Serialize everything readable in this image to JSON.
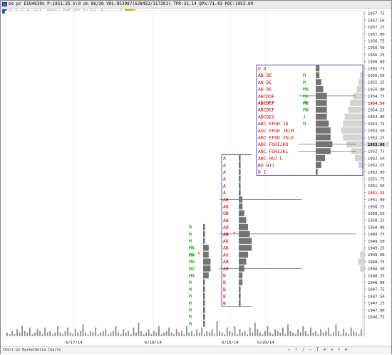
{
  "window": {
    "title_bar": "es pr ESU4630n P:1951.25 V:0 on 06/20 VOL:852987(628452/117281) TPR:31.14 QPx:71.43 POC:1953.00",
    "subtitle_prefix": "Market Profile MCD14 CME  All Rights Reserved",
    "subtitle_mark": "DCSu",
    "footer_label": "Chart by MarketDelta Charts"
  },
  "colors": {
    "accent_red": "#cc0000",
    "profile_red": "#c00000",
    "profile_green": "#009000",
    "histogram_bar": "#737373",
    "profile_box_border": "#2a2a9e",
    "last_price_label": "#ff0000"
  },
  "chart_data": {
    "type": "bar",
    "title": "",
    "xlabel": "",
    "ylabel": "",
    "ylim": [
      1946.75,
      1957.75
    ],
    "tick_step": 0.25,
    "price_ticks": [
      "1957.75",
      "1957.50",
      "1957.25",
      "1957.00",
      "1956.75",
      "1956.50",
      "1956.25",
      "1956.00",
      "1955.75",
      "1955.50",
      "1955.25",
      "1955.00",
      "1954.75",
      "1954.50",
      "1954.25",
      "1954.00",
      "1953.75",
      "1953.50",
      "1953.25",
      "1953.00",
      "1952.75",
      "1952.50",
      "1952.25",
      "1952.00",
      "1951.75",
      "1951.50",
      "1951.25",
      "1951.00",
      "1950.75",
      "1950.50",
      "1950.25",
      "1950.00",
      "1949.75",
      "1949.50",
      "1949.25",
      "1949.00",
      "1948.75",
      "1948.50",
      "1948.25",
      "1948.00",
      "1947.75",
      "1947.50",
      "1947.25",
      "1947.00",
      "1946.75"
    ],
    "highlighted_ticks": {
      "1954.50": "#cc0000",
      "1951.25": "#ff0000",
      "1953.00": "#000000"
    },
    "date_labels": [
      "6/17/14",
      "6/18/14",
      "6/19/14",
      "6/20/14"
    ],
    "profiles": [
      {
        "session": "6/18/14",
        "top": 1950.0,
        "rows": [
          "M",
          "M",
          "M",
          "MN",
          "MN",
          "MN",
          "MO",
          "MN",
          "M",
          "M",
          "M",
          "M",
          "M",
          "M",
          "M"
        ],
        "hist": [
          1,
          1,
          1,
          3,
          3,
          4,
          4,
          3,
          1,
          1,
          1,
          1,
          1,
          1,
          1
        ],
        "poc": 1949.0,
        "marker": "*"
      },
      {
        "session": "6/19/14",
        "top": 1952.5,
        "rows": [
          "A",
          "A",
          "A",
          "A",
          "A",
          "A",
          "AB",
          "AB",
          "OB",
          "AB",
          "AB",
          "AB",
          "AB",
          "AB",
          "AO",
          "AB",
          "AB",
          "B",
          "B",
          "B",
          "B",
          "B"
        ],
        "hist": [
          1,
          1,
          1,
          1,
          1,
          1,
          2,
          2,
          3,
          4,
          5,
          6,
          7,
          7,
          5,
          4,
          3,
          2,
          2,
          1,
          1,
          1
        ],
        "poc": 1949.75,
        "marker": "*",
        "value_area": [
          1951.0,
          1948.5
        ]
      },
      {
        "session": "6/20/14",
        "top": 1955.75,
        "rows": [
          "O D",
          "AB DE",
          "AB DE",
          "AB DE",
          "ABCDOF",
          "ABCDEF",
          "ABCDEF",
          "ABCDEO",
          "ABC EFGH JO",
          "AOC EFGH JKLM",
          "ABC EFOO JKLO",
          "ABC FGHIJKO",
          "ABC FGHIJKL",
          "ABC HOJ L",
          "BO HIJ",
          "B I"
        ],
        "right_letters": [
          "",
          "M",
          "M",
          "MN",
          "MO",
          "MN",
          "MN",
          "J",
          "M",
          "",
          "",
          "",
          "",
          "",
          "",
          ""
        ],
        "hist": [
          2,
          2,
          3,
          4,
          6,
          6,
          6,
          6,
          7,
          8,
          8,
          9,
          8,
          5,
          3,
          1
        ],
        "poc": 1954.5,
        "marker": "*"
      }
    ],
    "composite_right": [
      {
        "price": 1955.5,
        "value": 2
      },
      {
        "price": 1955.25,
        "value": 3
      },
      {
        "price": 1955.0,
        "value": 4
      },
      {
        "price": 1954.75,
        "value": 6
      },
      {
        "price": 1954.5,
        "value": 8
      },
      {
        "price": 1954.25,
        "value": 9
      },
      {
        "price": 1954.0,
        "value": 11
      },
      {
        "price": 1953.75,
        "value": 12
      },
      {
        "price": 1953.5,
        "value": 13
      },
      {
        "price": 1953.25,
        "value": 12
      },
      {
        "price": 1953.0,
        "value": 10
      },
      {
        "price": 1952.75,
        "value": 7
      },
      {
        "price": 1952.5,
        "value": 5
      },
      {
        "price": 1952.25,
        "value": 3
      },
      {
        "price": 1949.0,
        "value": 2
      },
      {
        "price": 1948.75,
        "value": 3
      },
      {
        "price": 1948.5,
        "value": 2
      }
    ],
    "volume": [
      2,
      1,
      3,
      1,
      4,
      2,
      6,
      3,
      2,
      5,
      1,
      2,
      4,
      3,
      1,
      5,
      2,
      3,
      1,
      2,
      6,
      2,
      1,
      3,
      5,
      2,
      1,
      4,
      2,
      3,
      7,
      2,
      1,
      3,
      2,
      5,
      1,
      2,
      3,
      4,
      1,
      2,
      3,
      6,
      2,
      1,
      4,
      2,
      3,
      1,
      5,
      2,
      8,
      3,
      1,
      2,
      4,
      1,
      3,
      2,
      6,
      1,
      2,
      3,
      5,
      2,
      1,
      4,
      2,
      3,
      1,
      6,
      2,
      3,
      1,
      4,
      2,
      5,
      1,
      3,
      2,
      4,
      1,
      9,
      3,
      2,
      1,
      5,
      3,
      2,
      6,
      1,
      4,
      2,
      3,
      1,
      5,
      2,
      8,
      4,
      2,
      1,
      3,
      6,
      2,
      1,
      4,
      3,
      2,
      5,
      1,
      7,
      3,
      2,
      1,
      4,
      2,
      6,
      3,
      1,
      5,
      2,
      3,
      1,
      4,
      2,
      3,
      5,
      1,
      2,
      7,
      3,
      1,
      4,
      2,
      1,
      5,
      3,
      2,
      1,
      4
    ],
    "reference_levels": [
      {
        "price": 1954.75,
        "from": 0.82,
        "to": 0.98
      },
      {
        "price": 1953.0,
        "from": 0.82,
        "to": 0.98
      },
      {
        "price": 1952.75,
        "from": 0.82,
        "to": 0.98
      },
      {
        "price": 1951.0,
        "from": 0.6,
        "to": 0.83
      },
      {
        "price": 1949.75,
        "from": 0.6,
        "to": 0.98
      },
      {
        "price": 1948.5,
        "from": 0.6,
        "to": 0.83
      }
    ]
  }
}
